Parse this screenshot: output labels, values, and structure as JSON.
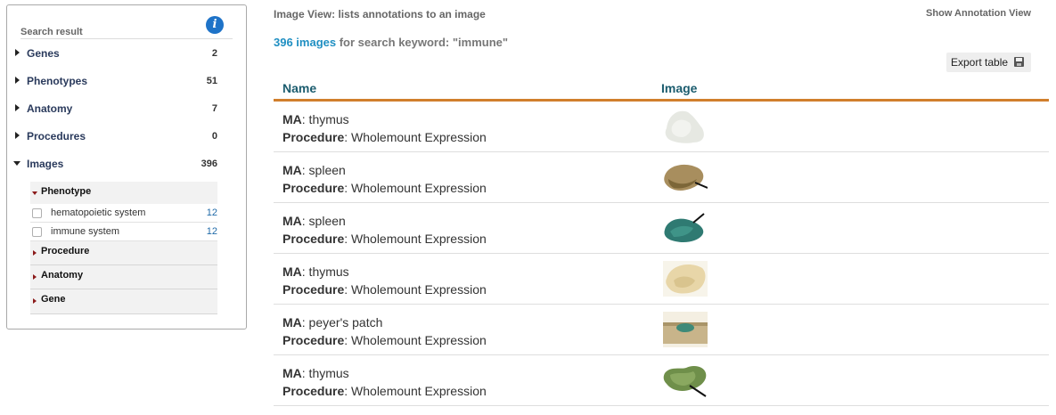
{
  "sidebar": {
    "title": "Search result",
    "info_icon": "info-icon",
    "facets": [
      {
        "label": "Genes",
        "count": "2",
        "expanded": false
      },
      {
        "label": "Phenotypes",
        "count": "51",
        "expanded": false
      },
      {
        "label": "Anatomy",
        "count": "7",
        "expanded": false
      },
      {
        "label": "Procedures",
        "count": "0",
        "expanded": false
      },
      {
        "label": "Images",
        "count": "396",
        "expanded": true
      }
    ],
    "images_subfacets": {
      "phenotype": {
        "label": "Phenotype",
        "options": [
          {
            "label": "hematopoietic system",
            "count": "12"
          },
          {
            "label": "immune system",
            "count": "12"
          }
        ]
      },
      "procedure": {
        "label": "Procedure"
      },
      "anatomy": {
        "label": "Anatomy"
      },
      "gene": {
        "label": "Gene"
      }
    }
  },
  "main": {
    "view_title": "Image View: lists annotations to an image",
    "show_annotation_view": "Show Annotation View",
    "summary_count": "396 images",
    "summary_text": " for search keyword: \"immune\"",
    "export_label": "Export table",
    "export_icon": "save-icon",
    "columns": {
      "name": "Name",
      "image": "Image"
    },
    "rows": [
      {
        "ma_label": "MA",
        "ma_value": ": thymus",
        "proc_label": "Procedure",
        "proc_value": ": Wholemount Expression",
        "thumb": "thymus-thumbnail"
      },
      {
        "ma_label": "MA",
        "ma_value": ": spleen",
        "proc_label": "Procedure",
        "proc_value": ": Wholemount Expression",
        "thumb": "spleen-thumbnail"
      },
      {
        "ma_label": "MA",
        "ma_value": ": spleen",
        "proc_label": "Procedure",
        "proc_value": ": Wholemount Expression",
        "thumb": "spleen-thumbnail"
      },
      {
        "ma_label": "MA",
        "ma_value": ": thymus",
        "proc_label": "Procedure",
        "proc_value": ": Wholemount Expression",
        "thumb": "thymus-thumbnail"
      },
      {
        "ma_label": "MA",
        "ma_value": ": peyer's patch",
        "proc_label": "Procedure",
        "proc_value": ": Wholemount Expression",
        "thumb": "peyers-patch-thumbnail"
      },
      {
        "ma_label": "MA",
        "ma_value": ": thymus",
        "proc_label": "Procedure",
        "proc_value": ": Wholemount Expression",
        "thumb": "thymus-thumbnail"
      }
    ]
  },
  "colors": {
    "accent_link": "#1f8fc2",
    "header_rule": "#d17f2c",
    "column_header": "#1b5c6e",
    "info_icon": "#1e73c8"
  }
}
